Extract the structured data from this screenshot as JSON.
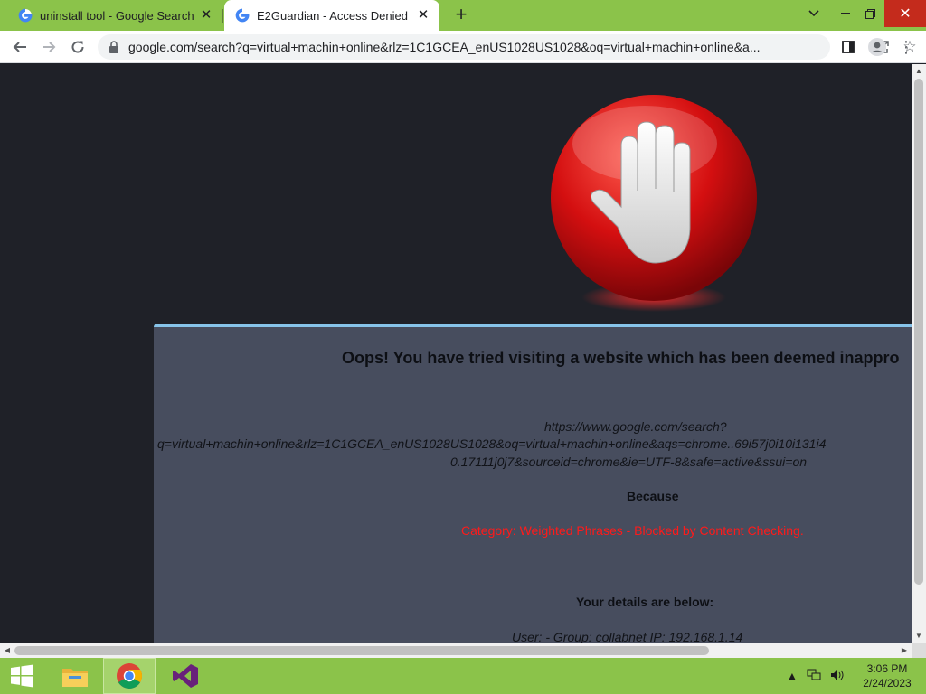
{
  "browser": {
    "tabs": [
      {
        "title": "uninstall tool - Google Search",
        "active": false,
        "favicon": "google-g-icon"
      },
      {
        "title": "E2Guardian - Access Denied",
        "active": true,
        "favicon": "google-g-icon"
      }
    ],
    "new_tab_label": "+",
    "address": "google.com/search?q=virtual+machin+online&rlz=1C1GCEA_enUS1028US1028&oq=virtual+machin+online&a...",
    "accent_color": "#8bc34a"
  },
  "page": {
    "headline": "Oops! You have tried visiting a website which has been deemed inappro",
    "blocked_url_line1": "https://www.google.com/search?",
    "blocked_url_line2": "q=virtual+machin+online&rlz=1C1GCEA_enUS1028US1028&oq=virtual+machin+online&aqs=chrome..69i57j0i10i131i4",
    "blocked_url_line3": "0.17111j0j7&sourceid=chrome&ie=UTF-8&safe=active&ssui=on",
    "because_label": "Because",
    "reason": "Category: Weighted Phrases - Blocked by Content Checking.",
    "details_heading": "Your details are below:",
    "user_line": "User: -   Group: collabnet   IP: 192.168.1.14",
    "reason_color": "#ff1a1a",
    "panel_border_color": "#87c4ea"
  },
  "taskbar": {
    "apps": [
      "windows-start-icon",
      "file-explorer-icon",
      "chrome-icon",
      "visual-studio-icon"
    ],
    "clock_time": "3:06 PM",
    "clock_date": "2/24/2023"
  }
}
